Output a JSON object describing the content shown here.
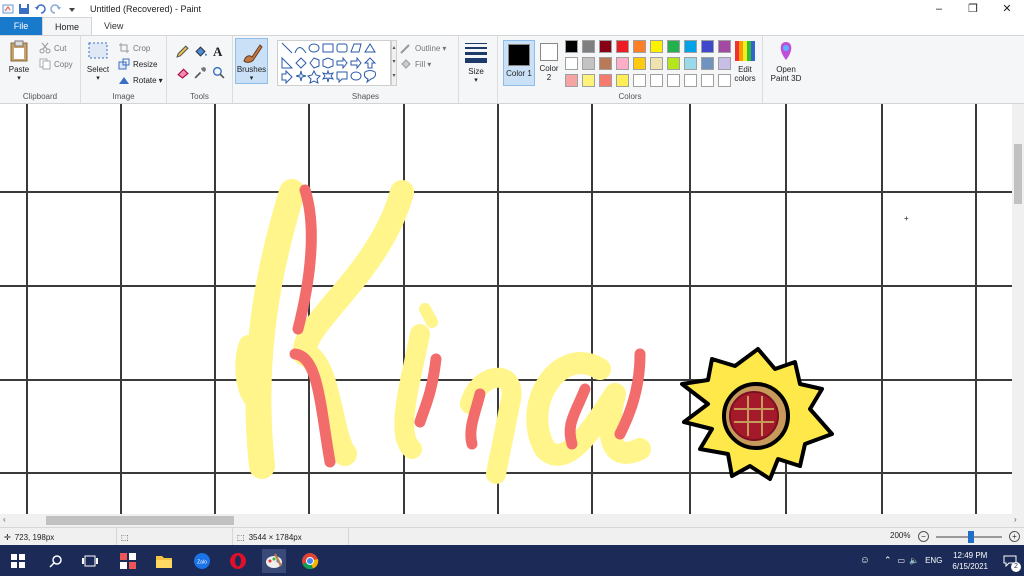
{
  "window": {
    "title": "Untitled (Recovered) - Paint",
    "minimize": "–",
    "maximize": "❐",
    "close": "✕"
  },
  "tabs": {
    "file": "File",
    "home": "Home",
    "view": "View"
  },
  "clipboard": {
    "paste": "Paste",
    "cut": "Cut",
    "copy": "Copy",
    "label": "Clipboard"
  },
  "image": {
    "select": "Select",
    "crop": "Crop",
    "resize": "Resize",
    "rotate": "Rotate",
    "label": "Image"
  },
  "tools": {
    "label": "Tools"
  },
  "brushes": {
    "label": "Brushes"
  },
  "shapes": {
    "outline": "Outline",
    "fill": "Fill",
    "label": "Shapes"
  },
  "size": {
    "label": "Size"
  },
  "colors": {
    "color1": "Color 1",
    "color2": "Color 2",
    "edit": "Edit colors",
    "open3d": "Open Paint 3D",
    "label": "Colors",
    "color1_value": "#000000",
    "color2_value": "#ffffff",
    "palette_row1": [
      "#000000",
      "#7f7f7f",
      "#880015",
      "#ed1c24",
      "#ff7f27",
      "#fff200",
      "#22b14c",
      "#00a2e8",
      "#3f48cc",
      "#a349a4"
    ],
    "palette_row2": [
      "#ffffff",
      "#c3c3c3",
      "#b97a57",
      "#ffaec9",
      "#ffc90e",
      "#efe4b0",
      "#b5e61d",
      "#99d9ea",
      "#7092be",
      "#c8bfe7"
    ],
    "palette_row3": [
      "#f5a3a3",
      "#fff27a",
      "#f77a6e",
      "#ffee55",
      "#ffffff",
      "#ffffff",
      "#ffffff",
      "#ffffff",
      "#ffffff",
      "#ffffff"
    ]
  },
  "canvas": {
    "text": "Kira",
    "accent_yellow": "#fff58a",
    "accent_red": "#f36c6c",
    "flower_petal": "#ffe84a",
    "flower_center": "#a41a2a"
  },
  "status": {
    "cursor": "723, 198px",
    "dimensions": "3544 × 1784px",
    "zoom": "200%"
  },
  "taskbar": {
    "lang": "ENG",
    "time": "12:49 PM",
    "date": "6/15/2021",
    "notif_count": "2"
  }
}
